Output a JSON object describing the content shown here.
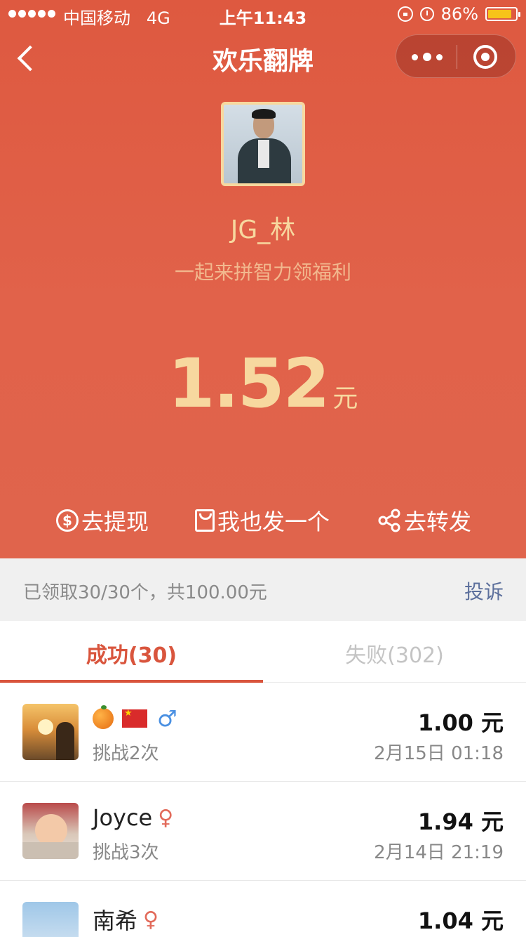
{
  "status_bar": {
    "carrier": "中国移动",
    "network": "4G",
    "time": "上午11:43",
    "battery": "86%",
    "battery_level": 0.86
  },
  "nav": {
    "title": "欢乐翻牌"
  },
  "profile": {
    "name": "JG_林",
    "slogan": "一起来拼智力领福利"
  },
  "amount": {
    "value": "1.52",
    "unit": "元"
  },
  "actions": {
    "withdraw": "去提现",
    "send_one": "我也发一个",
    "forward": "去转发"
  },
  "summary": {
    "text": "已领取30/30个，共100.00元",
    "report": "投诉"
  },
  "tabs": {
    "success": "成功(30)",
    "fail": "失败(302)"
  },
  "records": [
    {
      "name": "",
      "gender_symbol": "♂",
      "challenge": "挑战2次",
      "amount": "1.00 元",
      "date": "2月15日 01:18",
      "icons": [
        "orange-emoji-icon",
        "china-flag-icon",
        "male-icon"
      ]
    },
    {
      "name": "Joyce",
      "gender_symbol": "♀",
      "challenge": "挑战3次",
      "amount": "1.94 元",
      "date": "2月14日 21:19",
      "icons": [
        "female-icon"
      ]
    },
    {
      "name": "南希",
      "gender_symbol": "♀",
      "challenge": "",
      "amount": "1.04 元",
      "date": "",
      "icons": [
        "female-icon"
      ]
    }
  ],
  "colors": {
    "hero_background": "#e0604a",
    "gold_text": "#f7d89f",
    "accent": "#d9553d",
    "report_link": "#5c6f9c",
    "male": "#4a90e2",
    "female": "#e26a5a"
  },
  "icons": {
    "back": "chevron-left-icon",
    "more": "more-dots-icon",
    "close": "target-close-icon",
    "withdraw": "dollar-circle-icon",
    "send": "envelope-icon",
    "forward": "share-icon"
  }
}
